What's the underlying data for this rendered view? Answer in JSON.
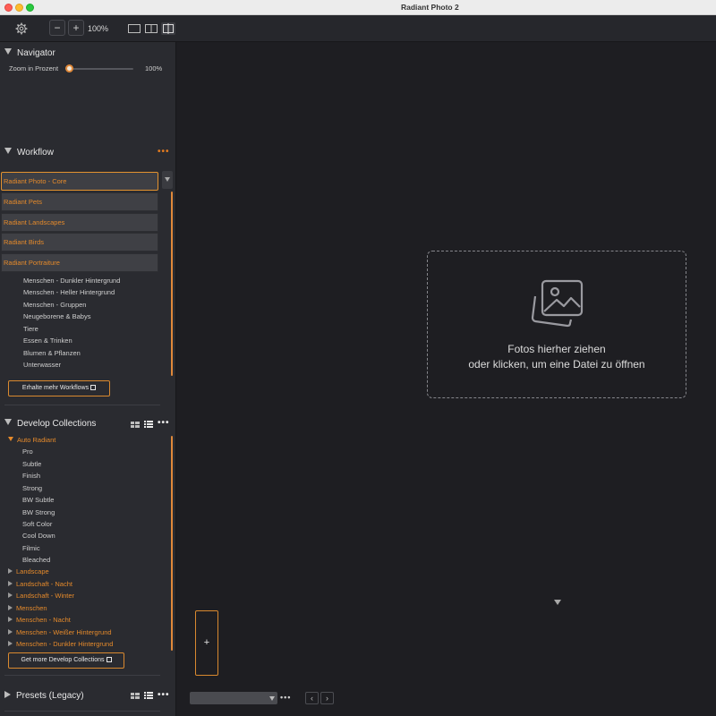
{
  "window": {
    "title": "Radiant Photo 2"
  },
  "toolbar": {
    "zoom_out_label": "−",
    "zoom_in_label": "+",
    "zoom_percent": "100%",
    "view_modes": [
      "single-view",
      "split-view",
      "compare-view"
    ],
    "active_view_mode": "compare-view"
  },
  "navigator": {
    "title": "Navigator",
    "zoom_label": "Zoom in Prozent",
    "zoom_value": "100%",
    "zoom_fraction": 0.0
  },
  "workflow": {
    "title": "Workflow",
    "more_label": "•••",
    "selected": "Radiant Photo - Core",
    "options": [
      "Radiant Pets",
      "Radiant Landscapes",
      "Radiant Birds",
      "Radiant Portraiture"
    ],
    "items": [
      "Menschen - Dunkler Hintergrund",
      "Menschen - Heller Hintergrund",
      "Menschen - Gruppen",
      "Neugeborene & Babys",
      "Tiere",
      "Essen & Trinken",
      "Blumen & Pflanzen",
      "Unterwasser"
    ],
    "more_button": "Erhalte mehr Workflows"
  },
  "develop_collections": {
    "title": "Develop Collections",
    "more_label": "•••",
    "expanded_group": "Auto Radiant",
    "expanded_items": [
      "Pro",
      "Subtle",
      "Finish",
      "Strong",
      "BW Subtle",
      "BW Strong",
      "Soft Color",
      "Cool Down",
      "Filmic",
      "Bleached"
    ],
    "groups": [
      "Landscape",
      "Landschaft - Nacht",
      "Landschaft - Winter",
      "Menschen",
      "Menschen - Nacht",
      "Menschen - Weißer Hintergrund",
      "Menschen - Dunkler Hintergrund"
    ],
    "more_button": "Get more Develop Collections"
  },
  "presets": {
    "title": "Presets (Legacy)",
    "more_label": "•••"
  },
  "main": {
    "drop_line1": "Fotos hierher ziehen",
    "drop_line2": "oder klicken, um eine Datei zu öffnen",
    "add_label": "+",
    "bottom_more": "•••",
    "prev_label": "‹",
    "next_label": "›"
  },
  "colors": {
    "accent": "#e58a2b",
    "sidebar_bg": "#2a2b30",
    "main_bg": "#1e1e22"
  }
}
